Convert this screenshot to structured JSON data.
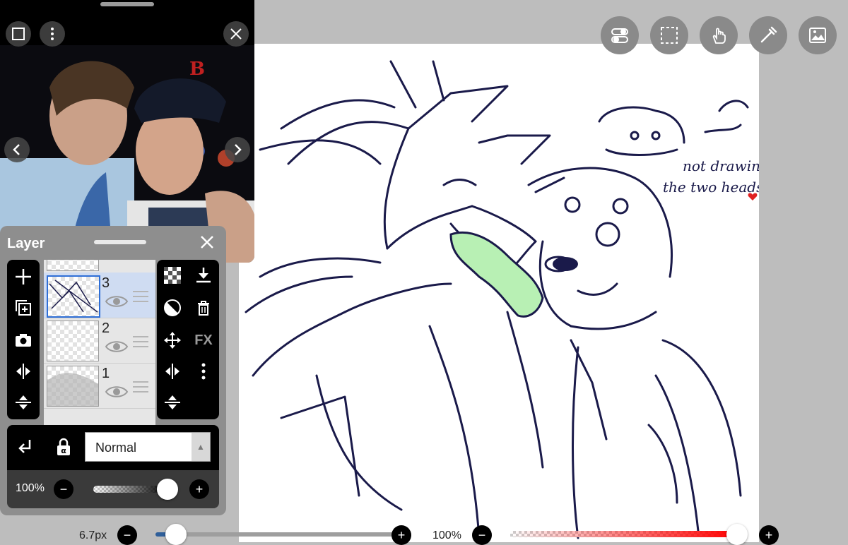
{
  "toolbar": {
    "icons": [
      "toggle-icon",
      "selection-icon",
      "hand-icon",
      "eyedropper-icon",
      "image-icon"
    ]
  },
  "reference_window": {
    "icons": [
      "window-icon",
      "more-icon",
      "close-icon",
      "previous-icon",
      "next-icon"
    ]
  },
  "canvas": {
    "note_line_1": "not drawing",
    "note_line_2": "the two heads",
    "highlight_color": "#b8f0b4",
    "line_color": "#1a1a4a"
  },
  "layer_panel": {
    "title": "Layer",
    "layers": [
      {
        "number": "3",
        "selected": true
      },
      {
        "number": "2",
        "selected": false
      },
      {
        "number": "1",
        "selected": false
      }
    ],
    "left_tools": [
      "add-layer-icon",
      "duplicate-layer-icon",
      "camera-icon",
      "flip-horizontal-icon",
      "flip-vertical-icon"
    ],
    "right_tools": [
      "transparency-icon",
      "merge-down-icon",
      "clip-icon",
      "trash-icon",
      "move-icon",
      "fx-icon",
      "flip-horizontal-icon",
      "more-icon",
      "flip-vertical-icon"
    ],
    "fx_label": "FX",
    "blend_mode": "Normal",
    "opacity_label": "100%",
    "opacity_value": 1.0
  },
  "bottom_bar": {
    "brush_size": "6.7px",
    "brush_opacity": "100%"
  }
}
